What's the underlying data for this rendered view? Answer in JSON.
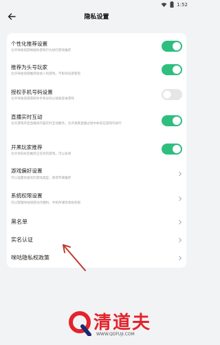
{
  "status_bar": {
    "time": "1:52",
    "icons": [
      "wifi-icon",
      "battery-icon"
    ]
  },
  "nav": {
    "title": "隐私设置",
    "back_icon": "back-arrow-icon"
  },
  "settings": [
    {
      "label": "个性化推荐设置",
      "desc": "允许咪咕快游根据你游戏行为进行游戏推荐",
      "control": "toggle",
      "on": true
    },
    {
      "label": "推荐为头号玩家",
      "desc": "允许咪咕快游推荐给他人的游戏，不影响向游客检",
      "control": "toggle",
      "on": true
    },
    {
      "label": "授权手机号码设置",
      "desc": "允许咪咕快游获取你手机号码以快速登录游戏",
      "control": "toggle",
      "on": false
    },
    {
      "label": "直播实时互动",
      "desc": "允许游戏开启直播间内容实时互动服务，允许观看直播过程中体验在游戏内进行",
      "control": "toggle",
      "on": true
    },
    {
      "label": "开黑玩家推荐",
      "desc": "允许你向好友推荐正在玩的游戏，可以关闭",
      "control": "toggle",
      "on": true
    },
    {
      "label": "游戏偏好设置",
      "desc": "可以设置你喜欢的游戏类型，获得专属推荐",
      "control": "chevron"
    },
    {
      "label": "系统权限设置",
      "desc": "可以管理咪咕快游访问相机、手机存储等系统权限",
      "control": "chevron"
    },
    {
      "label": "黑名单",
      "desc": "",
      "control": "chevron"
    },
    {
      "label": "实名认证",
      "desc": "",
      "control": "chevron"
    },
    {
      "label": "咪咕隐私权政策",
      "desc": "",
      "control": "chevron"
    }
  ],
  "watermark": {
    "text": "清道夫",
    "url": "WWW.QDFUJI.COM"
  },
  "colors": {
    "toggle_on": "#2ebf7f",
    "toggle_off": "#e6e6e6",
    "background": "#f2f3f5",
    "annotation": "#c0392b"
  }
}
